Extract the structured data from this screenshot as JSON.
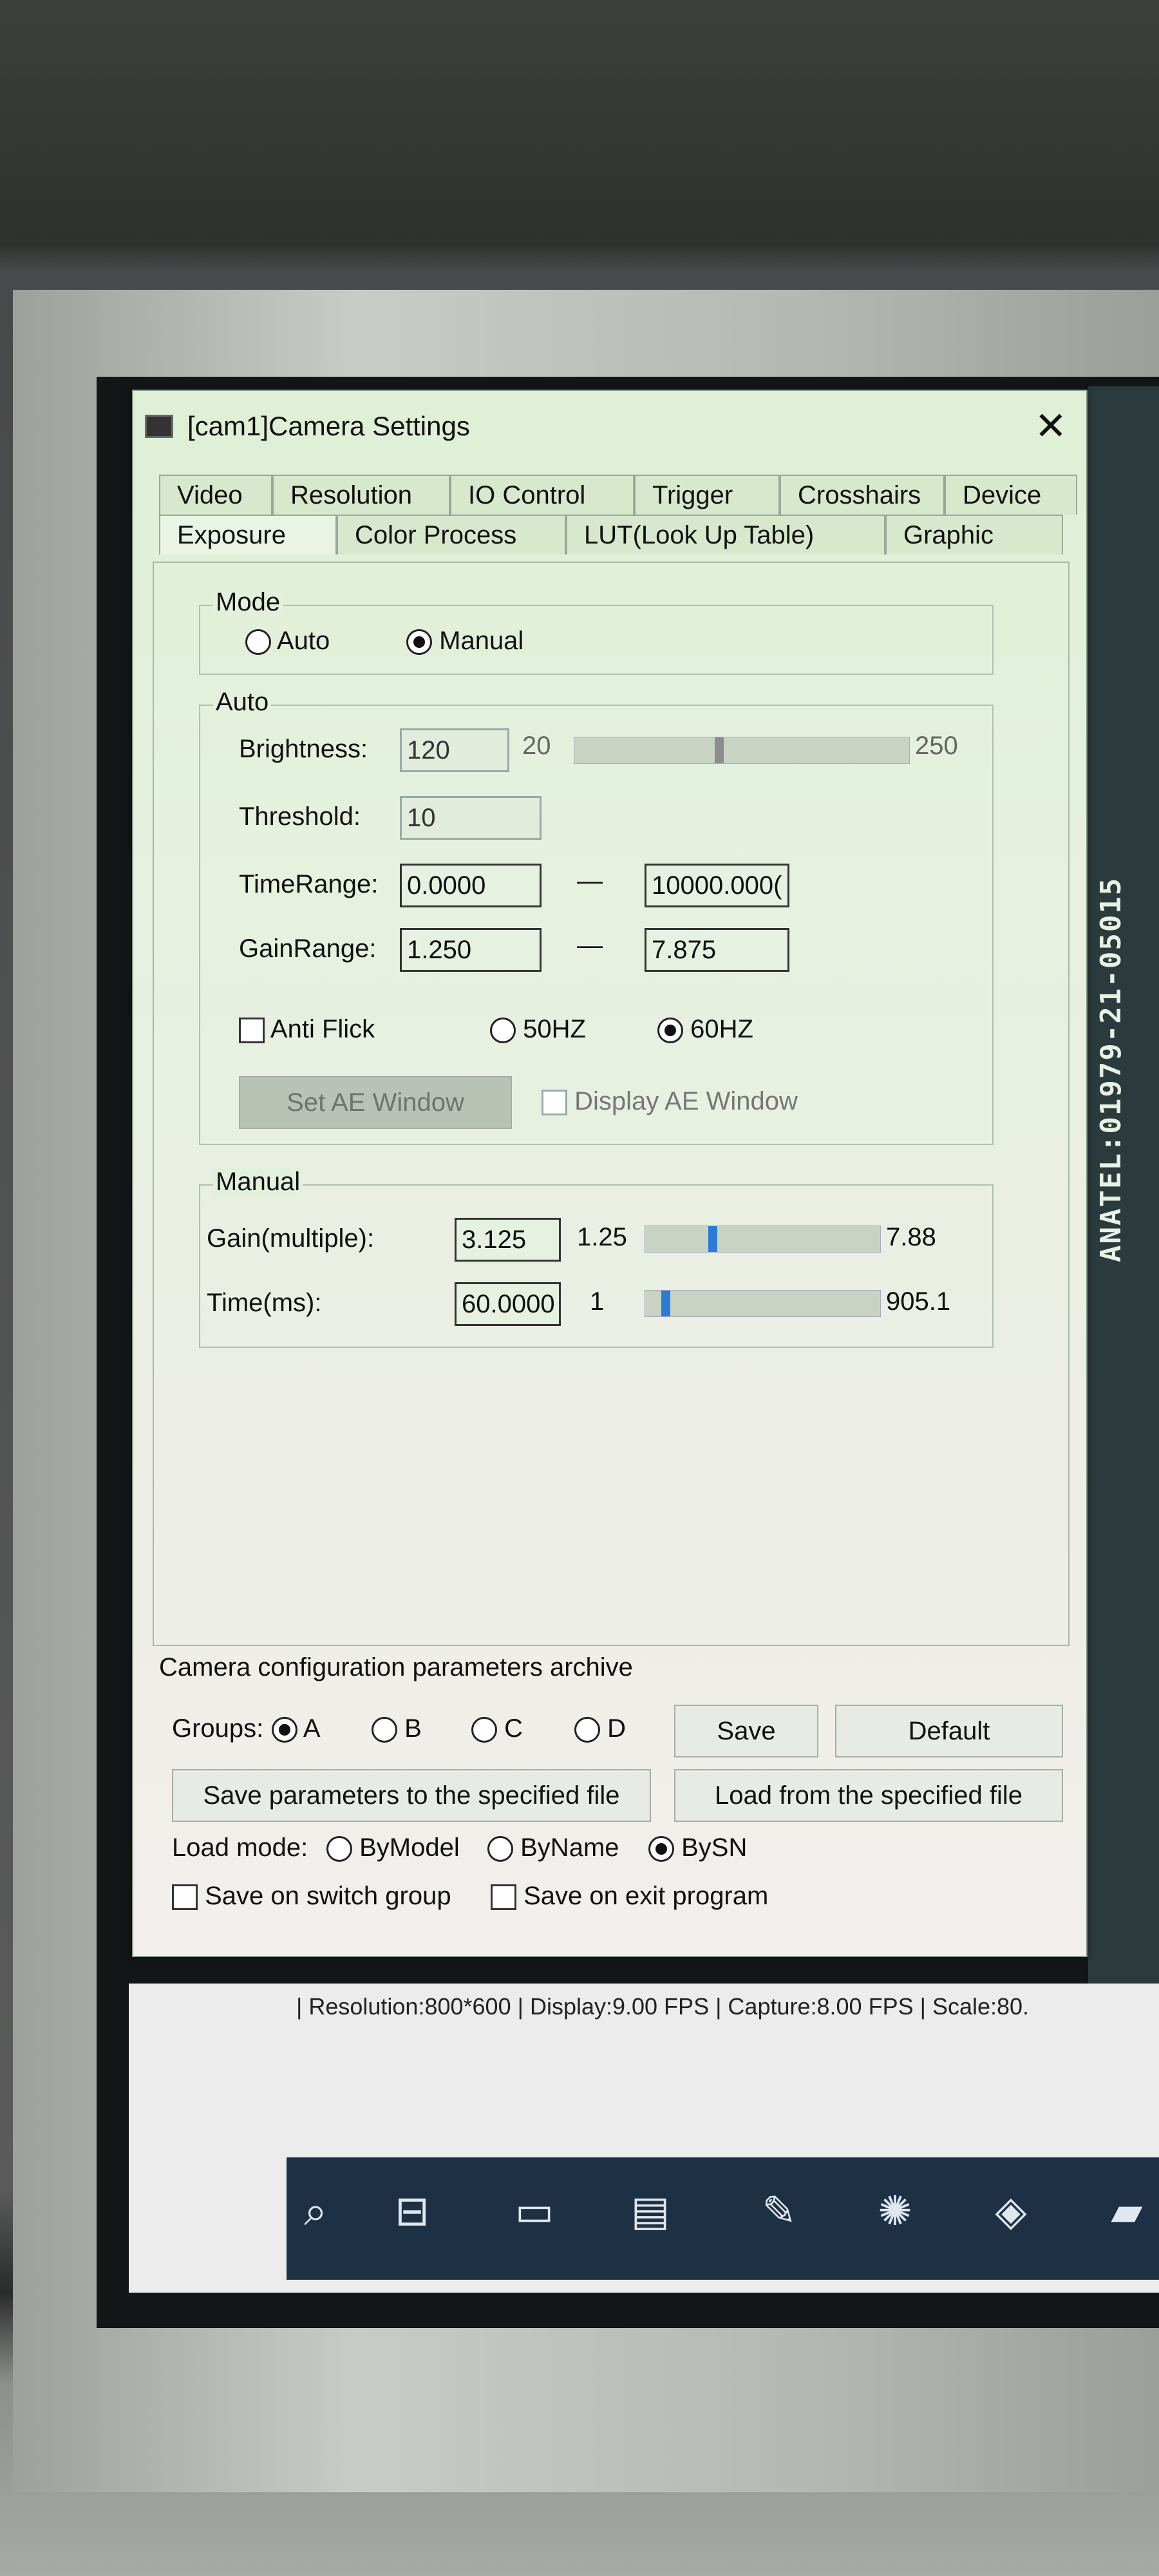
{
  "window": {
    "title": "[cam1]Camera Settings",
    "close_glyph": "✕",
    "tabs_row1": [
      "Video",
      "Resolution",
      "IO Control",
      "Trigger",
      "Crosshairs",
      "Device"
    ],
    "tabs_row2": [
      "Exposure",
      "Color Process",
      "LUT(Look Up Table)",
      "Graphic"
    ],
    "active_tab": "Exposure"
  },
  "mode": {
    "group_title": "Mode",
    "auto_label": "Auto",
    "manual_label": "Manual",
    "selected": "Manual"
  },
  "auto": {
    "group_title": "Auto",
    "brightness_label": "Brightness:",
    "brightness_value": "120",
    "brightness_min": "20",
    "brightness_max": "250",
    "brightness_level": 0.43,
    "threshold_label": "Threshold:",
    "threshold_value": "10",
    "timerange_label": "TimeRange:",
    "timerange_min": "0.0000",
    "timerange_max": "10000.000(",
    "gainrange_label": "GainRange:",
    "gainrange_min": "1.250",
    "gainrange_max": "7.875",
    "dash": "—",
    "anti_flick_label": "Anti Flick",
    "hz50_label": "50HZ",
    "hz60_label": "60HZ",
    "hz_selected": "60HZ",
    "set_ae_window_label": "Set AE Window",
    "display_ae_window_label": "Display AE Window"
  },
  "manual": {
    "group_title": "Manual",
    "gain_label": "Gain(multiple):",
    "gain_value": "3.125",
    "gain_min": "1.25",
    "gain_max": "7.88",
    "gain_level": 0.28,
    "time_label": "Time(ms):",
    "time_value": "60.0000",
    "time_min": "1",
    "time_max": "905.1",
    "time_level": 0.07
  },
  "archive": {
    "title": "Camera configuration parameters archive",
    "groups_label": "Groups:",
    "groups": [
      "A",
      "B",
      "C",
      "D"
    ],
    "group_selected": "A",
    "save_label": "Save",
    "default_label": "Default",
    "save_to_file_label": "Save parameters to the specified file",
    "load_from_file_label": "Load from the specified file",
    "load_mode_label": "Load mode:",
    "load_modes": [
      "ByModel",
      "ByName",
      "BySN"
    ],
    "load_mode_selected": "BySN",
    "save_on_switch_label": "Save on switch group",
    "save_on_exit_label": "Save on exit program"
  },
  "status_bar": {
    "text": "| Resolution:800*600 | Display:9.00 FPS | Capture:8.00 FPS | Scale:80."
  },
  "background_label": {
    "anatel": "ANATEL:01979-21-05015"
  },
  "taskbar": {
    "icons": [
      "search-icon",
      "task-view-icon",
      "app-icon",
      "notepad-icon",
      "paint-icon",
      "network-icon",
      "brush-icon",
      "folder-icon"
    ]
  }
}
